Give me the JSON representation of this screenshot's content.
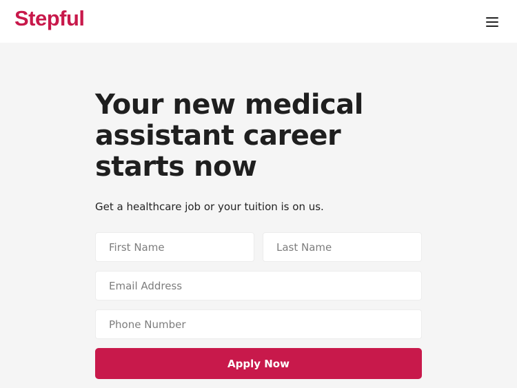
{
  "brand": {
    "logo_text": "Stepful",
    "accent_color": "#c8194b"
  },
  "header": {
    "menu_icon": "hamburger-menu-icon"
  },
  "hero": {
    "title": "Your new medical assistant career starts now",
    "subtitle": "Get a healthcare job or your tuition is on us."
  },
  "form": {
    "first_name": {
      "placeholder": "First Name",
      "value": ""
    },
    "last_name": {
      "placeholder": "Last Name",
      "value": ""
    },
    "email": {
      "placeholder": "Email Address",
      "value": ""
    },
    "phone": {
      "placeholder": "Phone Number",
      "value": ""
    },
    "submit_label": "Apply Now"
  }
}
